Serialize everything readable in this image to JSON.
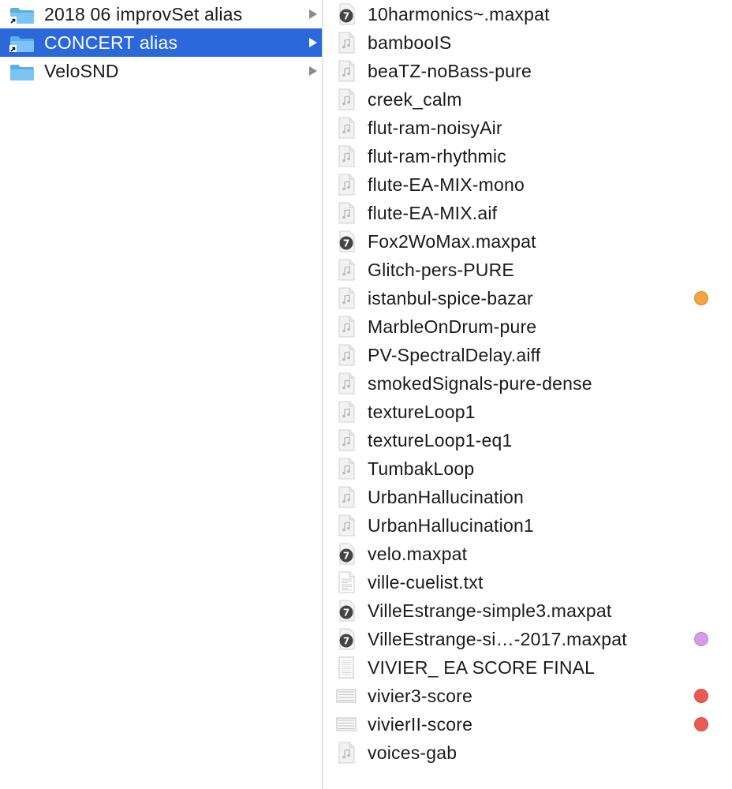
{
  "folders": [
    {
      "label": "2018 06 improvSet alias",
      "icon": "folder-alias-icon",
      "selected": false
    },
    {
      "label": "CONCERT alias",
      "icon": "folder-alias-icon",
      "selected": true
    },
    {
      "label": "VeloSND",
      "icon": "folder-icon",
      "selected": false
    }
  ],
  "files": [
    {
      "label": "10harmonics~.maxpat",
      "icon": "max-patch-icon",
      "tag": null
    },
    {
      "label": "bambooIS",
      "icon": "audio-file-icon",
      "tag": null
    },
    {
      "label": "beaTZ-noBass-pure",
      "icon": "audio-file-icon",
      "tag": null
    },
    {
      "label": "creek_calm",
      "icon": "audio-file-icon",
      "tag": null
    },
    {
      "label": "flut-ram-noisyAir",
      "icon": "audio-file-icon",
      "tag": null
    },
    {
      "label": "flut-ram-rhythmic",
      "icon": "audio-file-icon",
      "tag": null
    },
    {
      "label": "flute-EA-MIX-mono",
      "icon": "audio-file-icon",
      "tag": null
    },
    {
      "label": "flute-EA-MIX.aif",
      "icon": "audio-file-icon",
      "tag": null
    },
    {
      "label": "Fox2WoMax.maxpat",
      "icon": "max-patch-icon",
      "tag": null
    },
    {
      "label": "Glitch-pers-PURE",
      "icon": "audio-file-icon",
      "tag": null
    },
    {
      "label": "istanbul-spice-bazar",
      "icon": "audio-file-icon",
      "tag": "#f5a442"
    },
    {
      "label": "MarbleOnDrum-pure",
      "icon": "audio-file-icon",
      "tag": null
    },
    {
      "label": "PV-SpectralDelay.aiff",
      "icon": "audio-file-icon",
      "tag": null
    },
    {
      "label": "smokedSignals-pure-dense",
      "icon": "audio-file-icon",
      "tag": null
    },
    {
      "label": "textureLoop1",
      "icon": "audio-file-icon",
      "tag": null
    },
    {
      "label": "textureLoop1-eq1",
      "icon": "audio-file-icon",
      "tag": null
    },
    {
      "label": "TumbakLoop",
      "icon": "audio-file-icon",
      "tag": null
    },
    {
      "label": "UrbanHallucination",
      "icon": "audio-file-icon",
      "tag": null
    },
    {
      "label": "UrbanHallucination1",
      "icon": "audio-file-icon",
      "tag": null
    },
    {
      "label": "velo.maxpat",
      "icon": "max-patch-icon",
      "tag": null
    },
    {
      "label": "ville-cuelist.txt",
      "icon": "text-file-icon",
      "tag": null
    },
    {
      "label": "VilleEstrange-simple3.maxpat",
      "icon": "max-patch-icon",
      "tag": null
    },
    {
      "label": "VilleEstrange-si…-2017.maxpat",
      "icon": "max-patch-icon",
      "tag": "#d59ae8"
    },
    {
      "label": "VIVIER_ EA SCORE FINAL",
      "icon": "document-icon",
      "tag": null
    },
    {
      "label": "vivier3-score",
      "icon": "score-file-icon",
      "tag": "#ee5a52"
    },
    {
      "label": "vivierII-score",
      "icon": "score-file-icon",
      "tag": "#ee5a52"
    },
    {
      "label": "voices-gab",
      "icon": "audio-file-icon",
      "tag": null
    }
  ],
  "colors": {
    "selection": "#2b68d9",
    "folder": "#6cb7f0"
  }
}
